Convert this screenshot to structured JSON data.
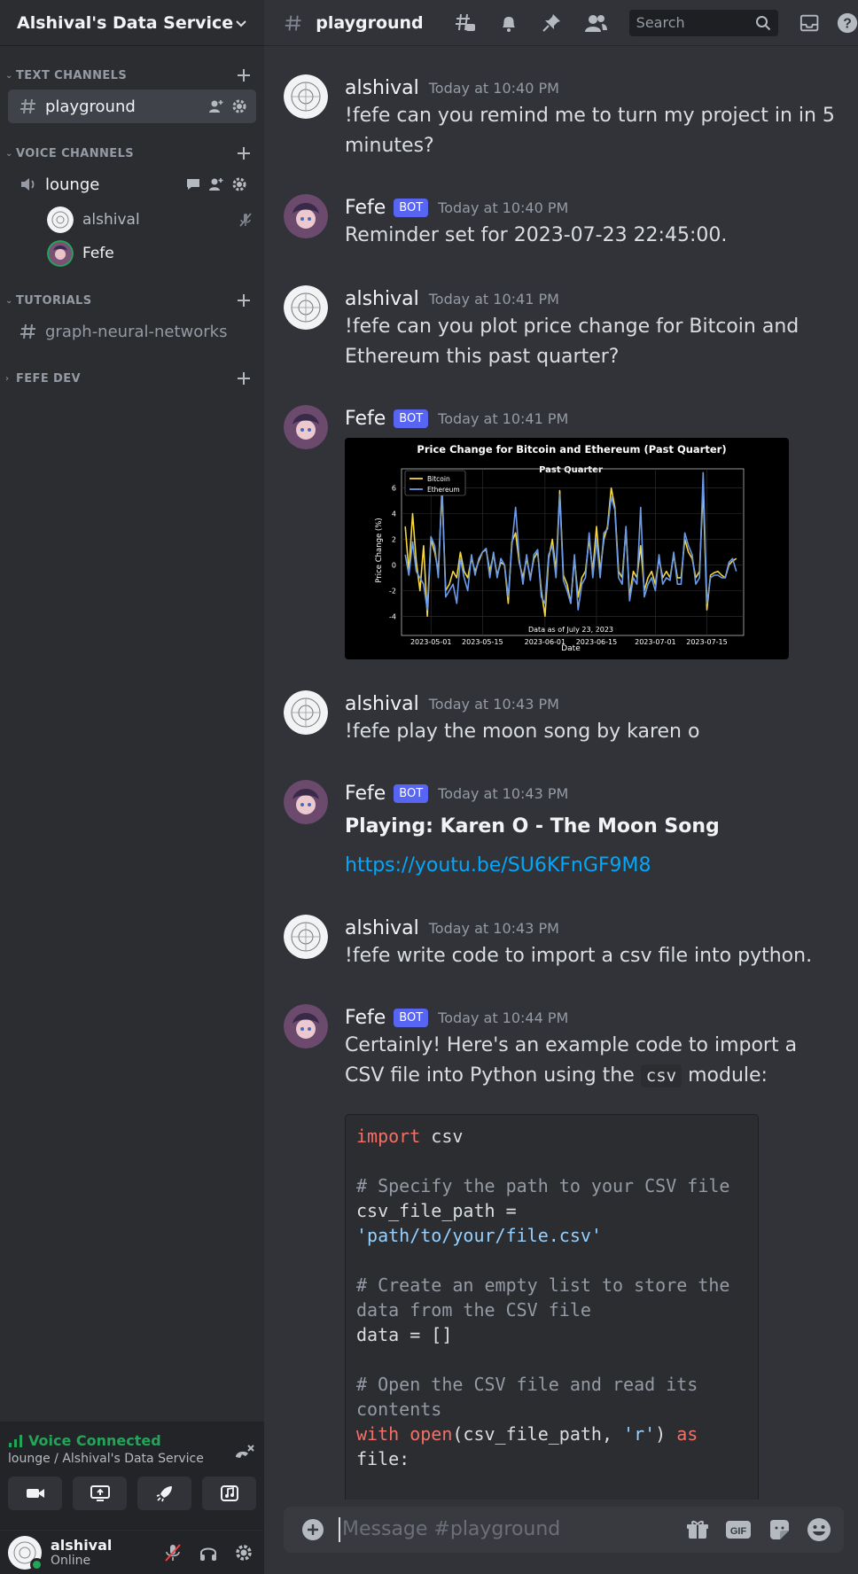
{
  "server": {
    "name": "Alshival's Data Service"
  },
  "categories": {
    "text": "TEXT CHANNELS",
    "voice": "VOICE CHANNELS",
    "tutorials": "TUTORIALS",
    "fefe_dev": "FEFE DEV"
  },
  "channels": {
    "playground": "playground",
    "lounge": "lounge",
    "graph": "graph-neural-networks"
  },
  "voice_users": [
    {
      "name": "alshival"
    },
    {
      "name": "Fefe"
    }
  ],
  "voice_panel": {
    "status": "Voice Connected",
    "location": "lounge / Alshival's Data Service"
  },
  "user_panel": {
    "name": "alshival",
    "status": "Online"
  },
  "topbar": {
    "channel": "playground",
    "search_placeholder": "Search"
  },
  "messages": [
    {
      "author": "alshival",
      "time": "Today at 10:40 PM",
      "text": "!fefe can you remind me to turn my project in in 5 minutes?"
    },
    {
      "author": "Fefe",
      "bot": "BOT",
      "time": "Today at 10:40 PM",
      "text": "Reminder set for 2023-07-23 22:45:00."
    },
    {
      "author": "alshival",
      "time": "Today at 10:41 PM",
      "text": "!fefe can you plot price change for Bitcoin and Ethereum this past quarter?"
    },
    {
      "author": "Fefe",
      "bot": "BOT",
      "time": "Today at 10:41 PM"
    },
    {
      "author": "alshival",
      "time": "Today at 10:43 PM",
      "text": "!fefe play the moon song by karen o"
    },
    {
      "author": "Fefe",
      "bot": "BOT",
      "time": "Today at 10:43 PM",
      "title": "Playing: Karen O - The Moon Song",
      "link": "https://youtu.be/SU6KFnGF9M8"
    },
    {
      "author": "alshival",
      "time": "Today at 10:43 PM",
      "text": "!fefe write code to import a csv file into python."
    },
    {
      "author": "Fefe",
      "bot": "BOT",
      "time": "Today at 10:44 PM",
      "text_before": "Certainly! Here's an example code to import a CSV file into Python using the",
      "code_inline": "csv",
      "text_after": "module:"
    }
  ],
  "code_lines": [
    {
      "t": "import csv"
    },
    {
      "t": ""
    },
    {
      "t": "# Specify the path to your CSV file"
    },
    {
      "t": "csv_file_path = 'path/to/your/file.csv'"
    },
    {
      "t": ""
    },
    {
      "t": "# Create an empty list to store the data from the CSV file"
    },
    {
      "t": "data = []"
    },
    {
      "t": ""
    },
    {
      "t": "# Open the CSV file and read its contents"
    },
    {
      "t": "with open(csv_file_path, 'r') as file:"
    }
  ],
  "composer": {
    "placeholder": "Message #playground"
  },
  "colors": {
    "accent": "#5865f2",
    "online": "#23a559",
    "link": "#00a8fc",
    "bitcoin": "#f5d63d",
    "ethereum": "#6a9ae8"
  },
  "chart_data": {
    "type": "line",
    "title": "Price Change for Bitcoin and Ethereum (Past Quarter)",
    "subtitle": "Past Quarter",
    "xlabel": "Date",
    "ylabel": "Price Change (%)",
    "annotation": "Data as of July 23, 2023",
    "x_ticks": [
      "2023-05-01",
      "2023-05-15",
      "2023-06-01",
      "2023-06-15",
      "2023-07-01",
      "2023-07-15"
    ],
    "y_ticks": [
      -4,
      -2,
      0,
      2,
      4,
      6
    ],
    "ylim": [
      -5.5,
      7.5
    ],
    "xlim": [
      "2023-04-23",
      "2023-07-25"
    ],
    "legend": "top-left",
    "grid": true,
    "x": [
      "2023-04-24",
      "2023-04-25",
      "2023-04-26",
      "2023-04-27",
      "2023-04-28",
      "2023-04-29",
      "2023-04-30",
      "2023-05-01",
      "2023-05-02",
      "2023-05-03",
      "2023-05-04",
      "2023-05-05",
      "2023-05-06",
      "2023-05-07",
      "2023-05-08",
      "2023-05-09",
      "2023-05-10",
      "2023-05-11",
      "2023-05-12",
      "2023-05-13",
      "2023-05-14",
      "2023-05-15",
      "2023-05-16",
      "2023-05-17",
      "2023-05-18",
      "2023-05-19",
      "2023-05-20",
      "2023-05-21",
      "2023-05-22",
      "2023-05-23",
      "2023-05-24",
      "2023-05-25",
      "2023-05-26",
      "2023-05-27",
      "2023-05-28",
      "2023-05-29",
      "2023-05-30",
      "2023-05-31",
      "2023-06-01",
      "2023-06-02",
      "2023-06-03",
      "2023-06-04",
      "2023-06-05",
      "2023-06-06",
      "2023-06-07",
      "2023-06-08",
      "2023-06-09",
      "2023-06-10",
      "2023-06-11",
      "2023-06-12",
      "2023-06-13",
      "2023-06-14",
      "2023-06-15",
      "2023-06-16",
      "2023-06-17",
      "2023-06-18",
      "2023-06-19",
      "2023-06-20",
      "2023-06-21",
      "2023-06-22",
      "2023-06-23",
      "2023-06-24",
      "2023-06-25",
      "2023-06-26",
      "2023-06-27",
      "2023-06-28",
      "2023-06-29",
      "2023-06-30",
      "2023-07-01",
      "2023-07-02",
      "2023-07-03",
      "2023-07-04",
      "2023-07-05",
      "2023-07-06",
      "2023-07-07",
      "2023-07-08",
      "2023-07-09",
      "2023-07-10",
      "2023-07-11",
      "2023-07-12",
      "2023-07-13",
      "2023-07-14",
      "2023-07-15",
      "2023-07-16",
      "2023-07-17",
      "2023-07-18",
      "2023-07-19",
      "2023-07-20",
      "2023-07-21",
      "2023-07-22",
      "2023-07-23"
    ],
    "series": [
      {
        "name": "Bitcoin",
        "color": "#f5d63d",
        "values": [
          3,
          -0.5,
          4,
          0.3,
          -2,
          1.5,
          -4,
          2,
          1,
          -0.5,
          5.8,
          -2,
          -1.5,
          -0.5,
          -1,
          1,
          -0.5,
          -1,
          0.5,
          -0.5,
          0.3,
          1,
          1.2,
          -0.5,
          0.8,
          -0.8,
          0.2,
          0,
          -3,
          1.8,
          2.5,
          0.2,
          -1,
          0.5,
          -1,
          0.5,
          1,
          -2,
          -4,
          0.5,
          2,
          -0.5,
          5.8,
          -0.8,
          -1.5,
          -3,
          0.5,
          -2.5,
          -1,
          -0.5,
          2,
          -0.5,
          3,
          -0.5,
          2,
          3,
          6,
          4.5,
          -0.5,
          -1,
          2.8,
          -2.5,
          -0.5,
          -1,
          1.5,
          -2,
          -1,
          -0.5,
          -1.5,
          0.5,
          -1,
          -0.5,
          -1,
          0.8,
          -1,
          -1,
          2,
          1,
          0.5,
          -1,
          -0.5,
          6,
          -3.5,
          -0.8,
          -0.6,
          -0.5,
          -0.8,
          -1,
          0,
          0.3,
          0.5
        ]
      },
      {
        "name": "Ethereum",
        "color": "#6a9ae8",
        "values": [
          0.8,
          -0.8,
          1.8,
          -0.5,
          -1,
          -1.5,
          -3.5,
          2.2,
          1.5,
          -1,
          6.3,
          -2.5,
          -2,
          -1.5,
          -3,
          0.5,
          -1,
          -2,
          0.8,
          -0.8,
          0.5,
          1,
          1.3,
          -1,
          1,
          -1,
          0.5,
          0,
          -2.5,
          1.5,
          4.5,
          0.5,
          -1.5,
          0.8,
          -1.2,
          0.8,
          1.2,
          -2.5,
          -3,
          0.8,
          1.5,
          -1,
          5.5,
          -1.2,
          -2,
          -3,
          0.8,
          -3.5,
          -1.5,
          -1,
          2.5,
          -1,
          2,
          -1,
          2.5,
          2.8,
          5.3,
          4.3,
          -1,
          -1.5,
          3,
          -2.8,
          -1,
          -1.5,
          4.5,
          -2.5,
          -1.5,
          -1,
          -2,
          0.8,
          -1.5,
          -1,
          -1.2,
          1,
          -1.5,
          -1.5,
          2.5,
          1.5,
          0.8,
          -1.5,
          -1,
          7.2,
          -3,
          -1,
          -0.8,
          -0.8,
          -1,
          -1,
          0.2,
          0.5,
          -0.5
        ]
      }
    ]
  }
}
